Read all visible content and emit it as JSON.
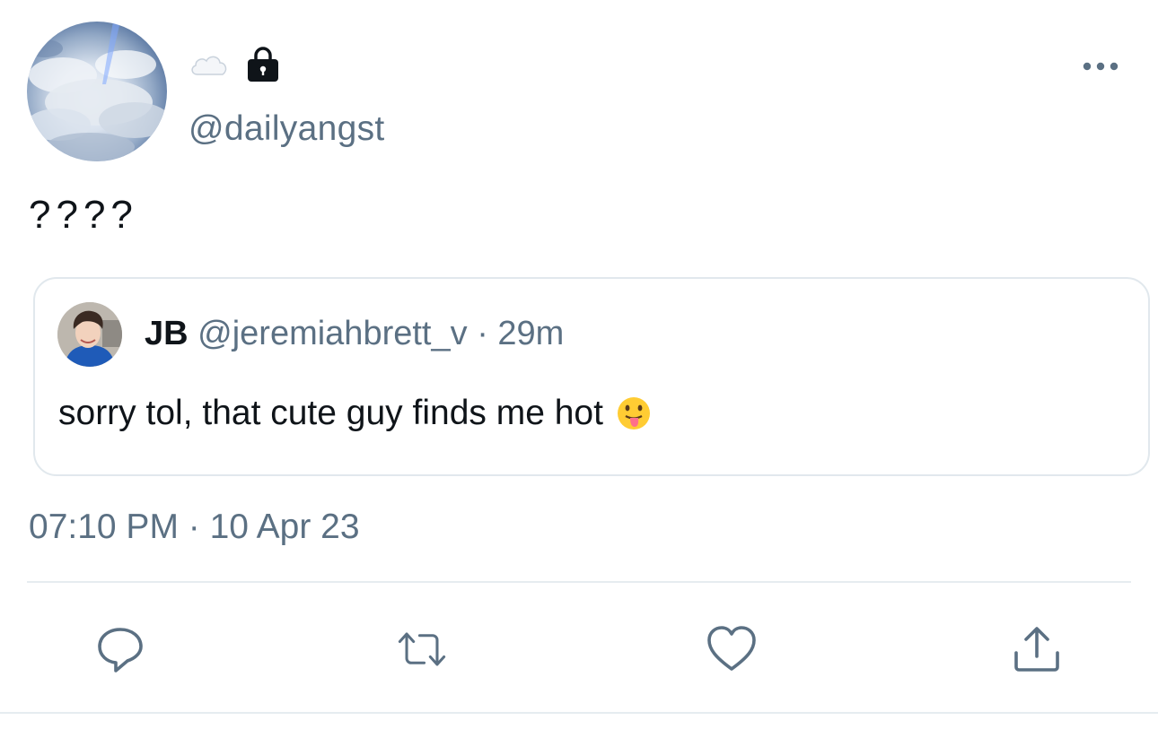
{
  "tweet": {
    "handle": "@dailyangst",
    "text": "????",
    "timestamp": "07:10 PM · 10 Apr 23",
    "icons": {
      "name_emoji": "cloud-icon",
      "protected": "lock-icon",
      "more": "more-icon"
    }
  },
  "quote": {
    "name": "JB",
    "handle": "@jeremiahbrett_v",
    "separator": "·",
    "time": "29m",
    "text": "sorry tol, that cute guy finds me hot",
    "emoji": "face-with-tongue-icon"
  },
  "actions": [
    "reply-icon",
    "retweet-icon",
    "like-icon",
    "share-icon"
  ],
  "colors": {
    "text_primary": "#0f1419",
    "text_secondary": "#5b7083",
    "border": "#e1e8ed",
    "icon": "#5b7083"
  }
}
